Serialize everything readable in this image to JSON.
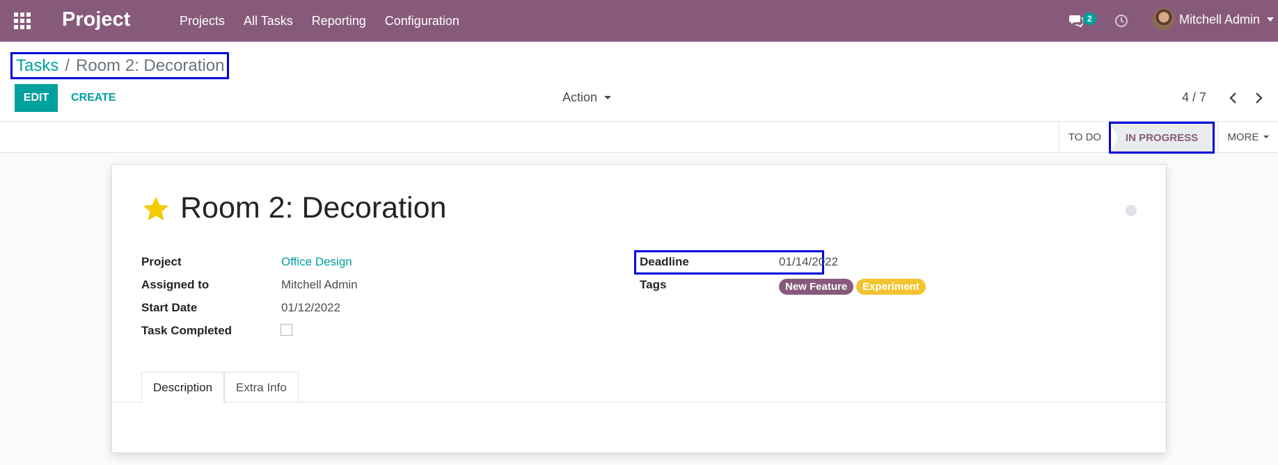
{
  "navbar": {
    "app_title": "Project",
    "menu": [
      "Projects",
      "All Tasks",
      "Reporting",
      "Configuration"
    ],
    "chat_count": "2",
    "user_name": "Mitchell Admin"
  },
  "control_panel": {
    "breadcrumb_parent": "Tasks",
    "breadcrumb_sep": "/",
    "breadcrumb_current": "Room 2: Decoration",
    "edit_label": "EDIT",
    "create_label": "CREATE",
    "action_label": "Action",
    "pager": "4 / 7"
  },
  "statusbar": {
    "stage_todo": "TO DO",
    "stage_in_progress": "IN PROGRESS",
    "more_label": "MORE"
  },
  "form": {
    "title": "Room 2: Decoration",
    "project_label": "Project",
    "project_value": "Office Design",
    "assigned_label": "Assigned to",
    "assigned_value": "Mitchell Admin",
    "start_label": "Start Date",
    "start_value": "01/12/2022",
    "completed_label": "Task Completed",
    "deadline_label": "Deadline",
    "deadline_value": "01/14/2022",
    "tags_label": "Tags",
    "tags": [
      "New Feature",
      "Experiment"
    ],
    "tabs": [
      "Description",
      "Extra Info"
    ]
  },
  "colors": {
    "brand": "#875a7b",
    "accent": "#00a09d",
    "highlight_box": "#0000dd",
    "tag_yellow": "#f4c430",
    "star": "#f3cc00"
  }
}
